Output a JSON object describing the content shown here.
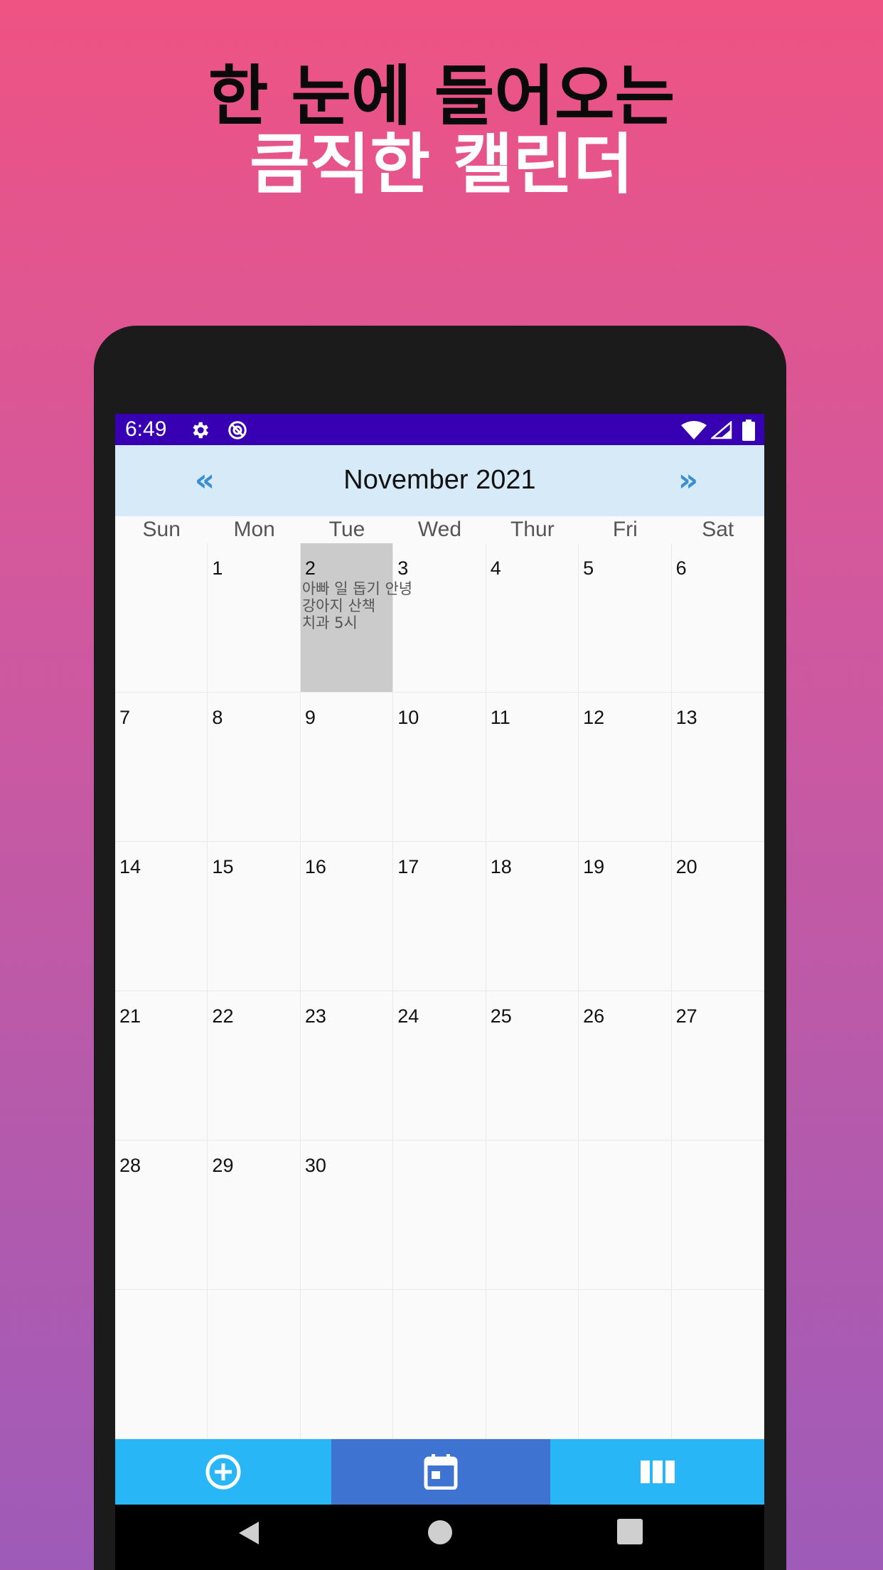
{
  "promo": {
    "line1": "한 눈에 들어오는",
    "line2": "큼직한 캘린더"
  },
  "status_bar": {
    "time": "6:49",
    "icons": [
      "gear-icon",
      "sync-icon",
      "wifi-icon",
      "signal-icon",
      "battery-icon"
    ],
    "color": "#3700b3"
  },
  "calendar": {
    "prev_label": "«",
    "next_label": "»",
    "month_title": "November 2021",
    "weekdays": [
      "Sun",
      "Mon",
      "Tue",
      "Wed",
      "Thur",
      "Fri",
      "Sat"
    ],
    "selected_day": "2",
    "days": [
      "",
      "1",
      "2",
      "3",
      "4",
      "5",
      "6",
      "7",
      "8",
      "9",
      "10",
      "11",
      "12",
      "13",
      "14",
      "15",
      "16",
      "17",
      "18",
      "19",
      "20",
      "21",
      "22",
      "23",
      "24",
      "25",
      "26",
      "27",
      "28",
      "29",
      "30",
      "",
      "",
      "",
      "",
      "",
      "",
      "",
      "",
      "",
      "",
      ""
    ],
    "events_day2": [
      "아빠 일 돕기 안녕",
      "강아지 산책",
      "치과 5시"
    ]
  },
  "bottom_nav": {
    "tabs": [
      "add-circle-icon",
      "calendar-icon",
      "week-view-icon"
    ],
    "active": "calendar-icon"
  },
  "system_nav": [
    "back-icon",
    "home-icon",
    "recents-icon"
  ],
  "colors": {
    "header_bg": "#d7eaf7",
    "nav_arrow": "#3a8fd0",
    "tab_bg": "#29b6f6",
    "tab_active_bg": "#3f73d2",
    "selected_cell": "#cbcbcb"
  }
}
